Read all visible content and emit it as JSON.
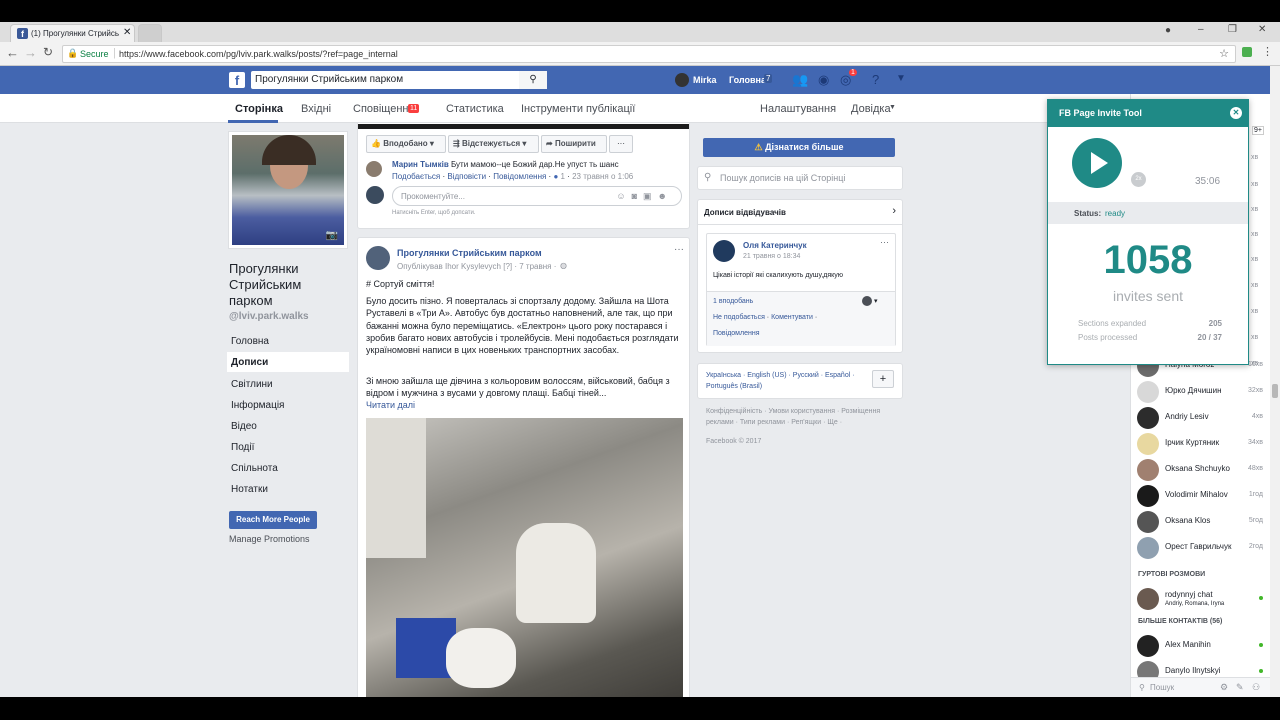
{
  "browser": {
    "tab_title": "(1) Прогулянки Стрийсь",
    "secure": "Secure",
    "url": "https://www.facebook.com/pg/lviv.park.walks/posts/?ref=page_internal"
  },
  "fb": {
    "search_value": "Прогулянки Стрийським парком",
    "user": "Mirka",
    "home": "Головна",
    "home_count": "7",
    "notif_count": "1"
  },
  "pagenav": {
    "tabs": [
      "Сторінка",
      "Вхідні",
      "Сповіщення",
      "Статистика",
      "Інструменти публікації"
    ],
    "notif_badge": "11",
    "settings": "Налаштування",
    "help": "Довідка"
  },
  "page": {
    "name": "Прогулянки Стрийським парком",
    "handle": "@lviv.park.walks",
    "nav": [
      "Головна",
      "Дописи",
      "Світлини",
      "Інформація",
      "Відео",
      "Події",
      "Спільнота",
      "Нотатки"
    ],
    "reach_btn": "Reach More People",
    "manage": "Manage Promotions"
  },
  "post1": {
    "actions": [
      "Вподобано",
      "Відстежується",
      "Поширити",
      "···"
    ],
    "learn_more": "Дізнатися більше",
    "comment_author": "Марин Тымків",
    "comment_text": "Бути мамою--це Божий дар.Не упуст ть шанс",
    "comment_links": [
      "Подобається",
      "Відповісти",
      "Повідомлення",
      "1",
      "23 травня о 1:06"
    ],
    "comment_placeholder": "Прокоментуйте...",
    "enter_hint": "Натисніть Enter, щоб допсати."
  },
  "post2": {
    "author": "Прогулянки Стрийським парком",
    "meta": "Опублікував Ihor Kysylevych [?] · 7 травня ·",
    "hashtag": "# Сортуй сміття!",
    "p1": "Було досить пізно. Я поверталась зі спортзалу додому. Зайшла на Шота Руставелі в «Три А». Автобус був достатньо наповнений, але так, що при бажанні можна було переміщатись. «Електрон» цього року постарався і зробив багато нових автобусів і тролейбусів. Мені подобається розглядати україномовні написи в цих новеньких транспортних засобах.",
    "p2": "Зі мною зайшла ще дівчина з кольоровим волоссям, військовий, бабця з відром і мужчина з вусами у довгому плащі. Бабці тіней...",
    "read_more": "Читати далі"
  },
  "right": {
    "search_placeholder": "Пошук дописів на цій Сторінці",
    "visitors_title": "Дописи відвідувачів",
    "visitor_name": "Оля Катеринчук",
    "visitor_time": "21 травня о 18:34",
    "visitor_text": "Цікаві історії які скалихують душу,дякую",
    "likes": "1 вподобань",
    "unlike": "Не подобається",
    "comment": "Коментувати",
    "message": "Повідомлення",
    "langs": "Українська · English (US) · Русский · Español · Português (Brasil)",
    "footer_links": "Конфіденційність · Умови користування · Розміщення реклами · Типи реклами · Реп'ящки · Ще ·",
    "copyright": "Facebook © 2017"
  },
  "tool": {
    "title": "FB Page Invite Tool",
    "speed": "2x",
    "time": "35:06",
    "status_label": "Status:",
    "status_value": "ready",
    "count": "1058",
    "count_label": "invites sent",
    "stats": [
      {
        "label": "Sections expanded",
        "value": "205"
      },
      {
        "label": "Posts processed",
        "value": "20 / 37"
      }
    ]
  },
  "chat": {
    "top_times": [
      "9+",
      "хв",
      "хв",
      "хв",
      "хв",
      "хв",
      "хв",
      "хв",
      "хв",
      "хв"
    ],
    "contacts": [
      {
        "name": "Halyna Moroz",
        "time": "16хв"
      },
      {
        "name": "Юрко Дячишин",
        "time": "32хв"
      },
      {
        "name": "Andriy Lesiv",
        "time": "4хв"
      },
      {
        "name": "Ірчик Куртяник",
        "time": "34хв"
      },
      {
        "name": "Oksana Shchuyko",
        "time": "48хв"
      },
      {
        "name": "Volodimir Mihalov",
        "time": "1год"
      },
      {
        "name": "Oksana Klos",
        "time": "5год"
      },
      {
        "name": "Орест Гаврильчук",
        "time": "2год"
      }
    ],
    "group_header": "ГУРТОВІ РОЗМОВИ",
    "group_name": "rodynnyj chat",
    "group_members": "Andriy, Romana, Iryna",
    "more_header": "БІЛЬШЕ КОНТАКТІВ (56)",
    "more": [
      {
        "name": "Alex Manihin"
      },
      {
        "name": "Danylo Ilnytskyi"
      }
    ],
    "search": "Пошук"
  }
}
